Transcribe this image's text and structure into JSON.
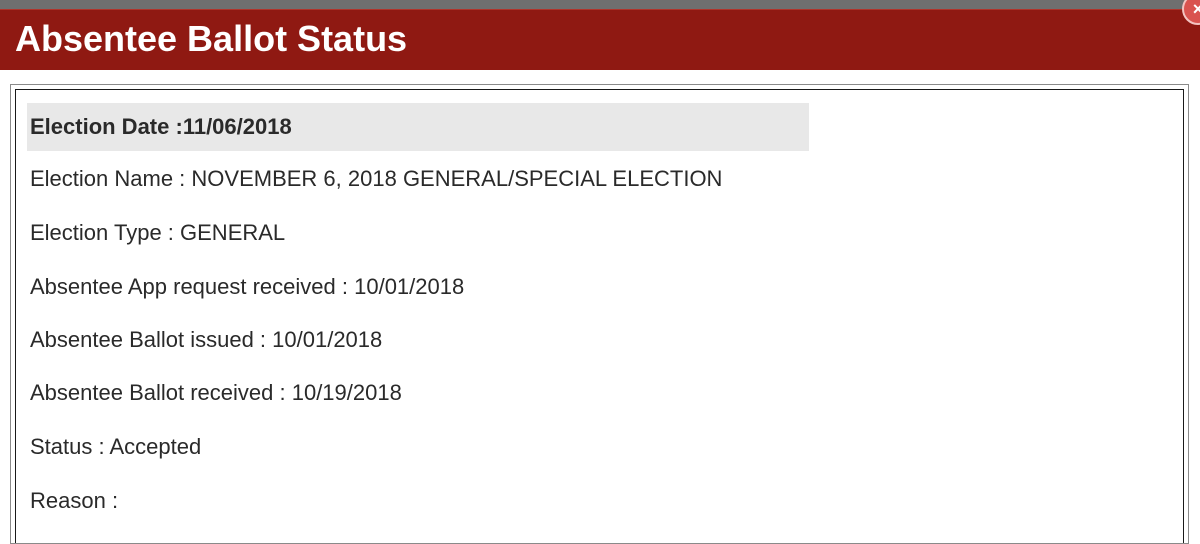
{
  "dialog": {
    "title": "Absentee Ballot Status",
    "close_glyph": "×"
  },
  "icons": {
    "close": "close-icon"
  },
  "colors": {
    "title_bar": "#8f1912",
    "header_row": "#e8e8e8",
    "close_button": "#d9534f"
  },
  "election": {
    "date_label": "Election Date :",
    "date": "11/06/2018",
    "name_label": "Election Name : ",
    "name": "NOVEMBER 6, 2018 GENERAL/SPECIAL ELECTION",
    "type_label": "Election Type : ",
    "type": "GENERAL",
    "app_received_label": "Absentee App request received : ",
    "app_received": "10/01/2018",
    "ballot_issued_label": "Absentee Ballot issued : ",
    "ballot_issued": "10/01/2018",
    "ballot_received_label": "Absentee Ballot received : ",
    "ballot_received": "10/19/2018",
    "status_label": "Status : ",
    "status": "Accepted",
    "reason_label": "Reason : ",
    "reason": ""
  }
}
